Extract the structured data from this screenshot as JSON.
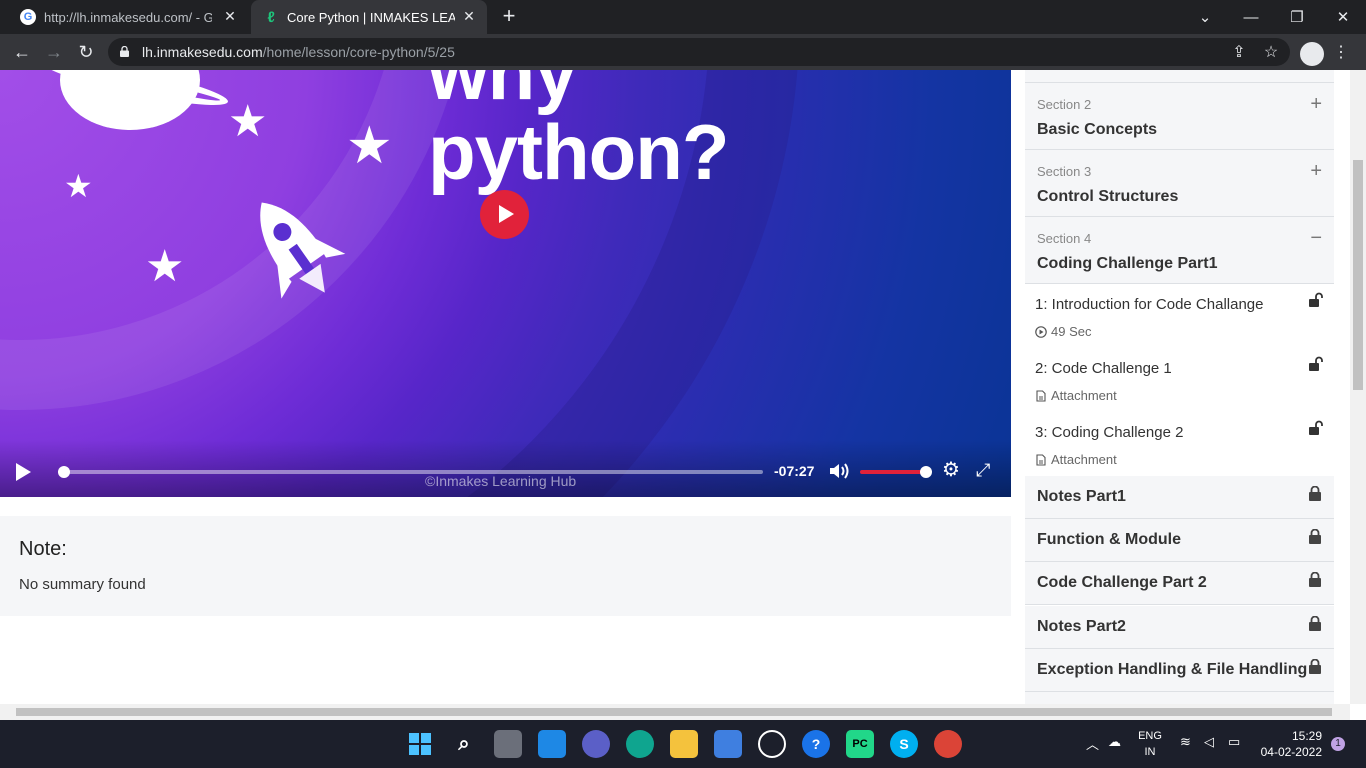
{
  "browser": {
    "tabs": [
      {
        "title": "http://lh.inmakesedu.com/ - Goo",
        "favicon": "G"
      },
      {
        "title": "Core Python | INMAKES LEARNIN",
        "favicon": "ℓ"
      }
    ],
    "url_host": "lh.inmakesedu.com",
    "url_path": "/home/lesson/core-python/5/25"
  },
  "video": {
    "headline_line1": "why",
    "headline_line2": "python?",
    "time_remaining": "-07:27",
    "progress_fraction": 0.0,
    "volume_fraction": 1.0,
    "watermark": "©Inmakes Learning Hub"
  },
  "note": {
    "title": "Note:",
    "text": "No summary found"
  },
  "sections": [
    {
      "label": "Section 2",
      "name": "Basic Concepts",
      "toggle": "+"
    },
    {
      "label": "Section 3",
      "name": "Control Structures",
      "toggle": "+"
    },
    {
      "label": "Section 4",
      "name": "Coding Challenge Part1",
      "toggle": "−"
    }
  ],
  "lessons": [
    {
      "title": "1: Introduction for Code Challange",
      "meta": "49 Sec",
      "meta_icon": "play-circle-icon"
    },
    {
      "title": "2: Code Challenge 1",
      "meta": "Attachment",
      "meta_icon": "file-icon"
    },
    {
      "title": "3: Coding Challenge 2",
      "meta": "Attachment",
      "meta_icon": "file-icon"
    }
  ],
  "locked_sections": [
    "Notes Part1",
    "Function & Module",
    "Code Challenge Part 2",
    "Notes Part2",
    "Exception Handling & File Handling"
  ],
  "taskbar": {
    "lang_line1": "ENG",
    "lang_line2": "IN",
    "time": "15:29",
    "date": "04-02-2022",
    "notifications": "1"
  },
  "colors": {
    "accent_red": "#e1223a",
    "titlebar": "#202124",
    "toolbar": "#35363a",
    "taskbar": "#1c1f2b"
  }
}
